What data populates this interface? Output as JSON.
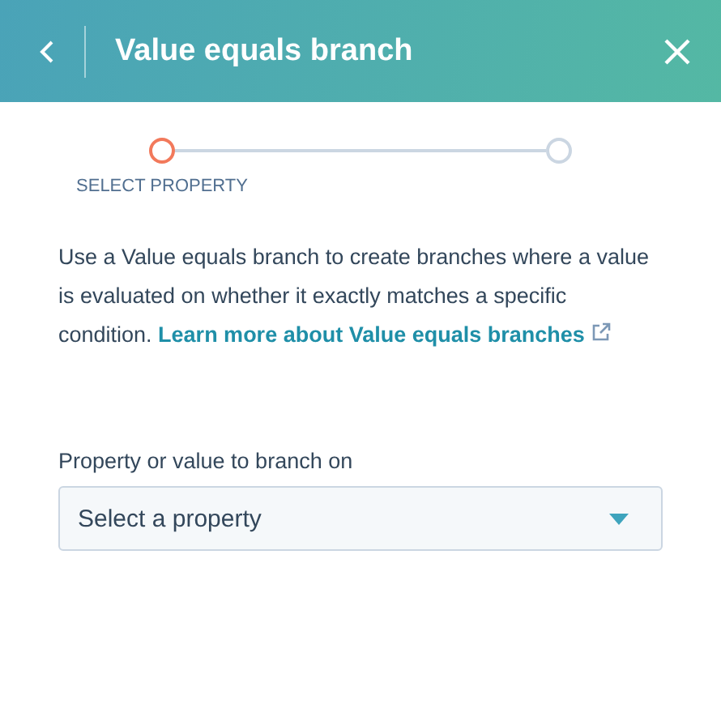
{
  "header": {
    "title": "Value equals branch"
  },
  "steps": [
    {
      "label": "SELECT PROPERTY",
      "selected": true
    },
    {
      "selected": false
    }
  ],
  "description": {
    "text": "Use a Value equals branch to create branches where a value is evaluated on whether it exactly matches a specific condition.",
    "link": "Learn more about Value equals branches"
  },
  "field": {
    "label": "Property or value to branch on",
    "placeholder": "Select a property"
  }
}
